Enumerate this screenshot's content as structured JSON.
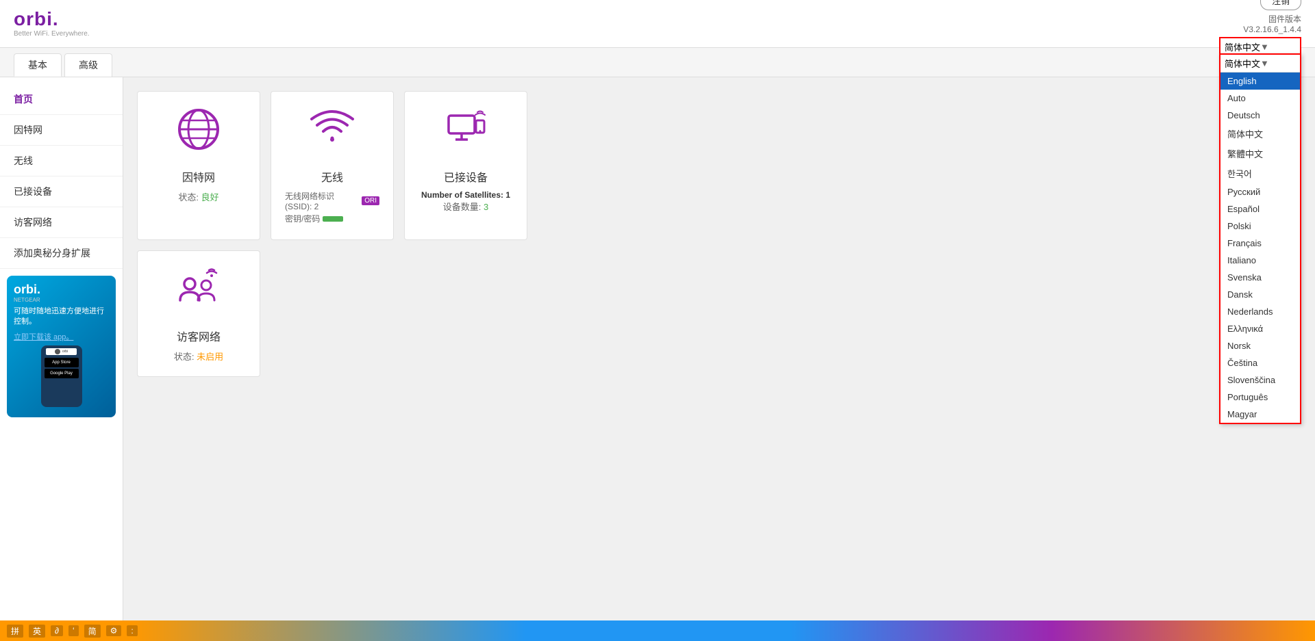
{
  "app": {
    "title": "Orbi",
    "tagline": "Better WiFi. Everywhere.",
    "firmware_label": "固件版本",
    "firmware_version": "V3.2.16.6_1.4.4"
  },
  "header": {
    "logout_button": "注销",
    "lang_current": "简体中文"
  },
  "tabs": [
    {
      "id": "basic",
      "label": "基本",
      "active": true
    },
    {
      "id": "advanced",
      "label": "高级",
      "active": false
    }
  ],
  "sidebar": {
    "items": [
      {
        "id": "home",
        "label": "首页",
        "active": true
      },
      {
        "id": "internet",
        "label": "因特网",
        "active": false
      },
      {
        "id": "wireless",
        "label": "无线",
        "active": false
      },
      {
        "id": "connected",
        "label": "已接设备",
        "active": false
      },
      {
        "id": "guest",
        "label": "访客网络",
        "active": false
      },
      {
        "id": "addon",
        "label": "添加奥秘分身扩展",
        "active": false
      }
    ],
    "ad": {
      "logo": "orbi.",
      "subtitle": "NETGEAR",
      "text": "可随时随地迅速方便地进行控制。",
      "link": "立即下载该 app。",
      "app_store": "App Store",
      "google_play": "GET IT ON\nGoogle Play"
    }
  },
  "cards": [
    {
      "id": "internet",
      "title": "因特网",
      "status_label": "状态: ",
      "status_value": "良好",
      "status_class": "good"
    },
    {
      "id": "wireless",
      "title": "无线",
      "ssid_label": "无线网络标识(SSID): 2",
      "ssid_badge": "ORI",
      "password_label": "密钥/密码"
    },
    {
      "id": "connected-devices",
      "title": "已接设备",
      "satellites_label": "Number of Satellites: 1",
      "devices_label": "设备数量: ",
      "devices_value": "3"
    },
    {
      "id": "guest-network",
      "title": "访客网络",
      "status_label": "状态: ",
      "status_value": "未启用",
      "status_class": "disabled"
    }
  ],
  "language_dropdown": {
    "select_label": "简体中文",
    "options": [
      {
        "value": "en",
        "label": "English",
        "selected": true
      },
      {
        "value": "auto",
        "label": "Auto",
        "selected": false
      },
      {
        "value": "de",
        "label": "Deutsch",
        "selected": false
      },
      {
        "value": "zh-cn",
        "label": "简体中文",
        "selected": false
      },
      {
        "value": "zh-tw",
        "label": "繁體中文",
        "selected": false
      },
      {
        "value": "ko",
        "label": "한국어",
        "selected": false
      },
      {
        "value": "ru",
        "label": "Русский",
        "selected": false
      },
      {
        "value": "es",
        "label": "Español",
        "selected": false
      },
      {
        "value": "pl",
        "label": "Polski",
        "selected": false
      },
      {
        "value": "fr",
        "label": "Français",
        "selected": false
      },
      {
        "value": "it",
        "label": "Italiano",
        "selected": false
      },
      {
        "value": "sv",
        "label": "Svenska",
        "selected": false
      },
      {
        "value": "da",
        "label": "Dansk",
        "selected": false
      },
      {
        "value": "nl",
        "label": "Nederlands",
        "selected": false
      },
      {
        "value": "el",
        "label": "Ελληνικά",
        "selected": false
      },
      {
        "value": "no",
        "label": "Norsk",
        "selected": false
      },
      {
        "value": "cs",
        "label": "Čeština",
        "selected": false
      },
      {
        "value": "sl",
        "label": "Slovenščina",
        "selected": false
      },
      {
        "value": "pt",
        "label": "Português",
        "selected": false
      },
      {
        "value": "hu",
        "label": "Magyar",
        "selected": false
      }
    ]
  },
  "taskbar": {
    "items": [
      "拼",
      "英",
      "∂",
      "ʻ",
      "简",
      "⚙",
      ":"
    ]
  }
}
